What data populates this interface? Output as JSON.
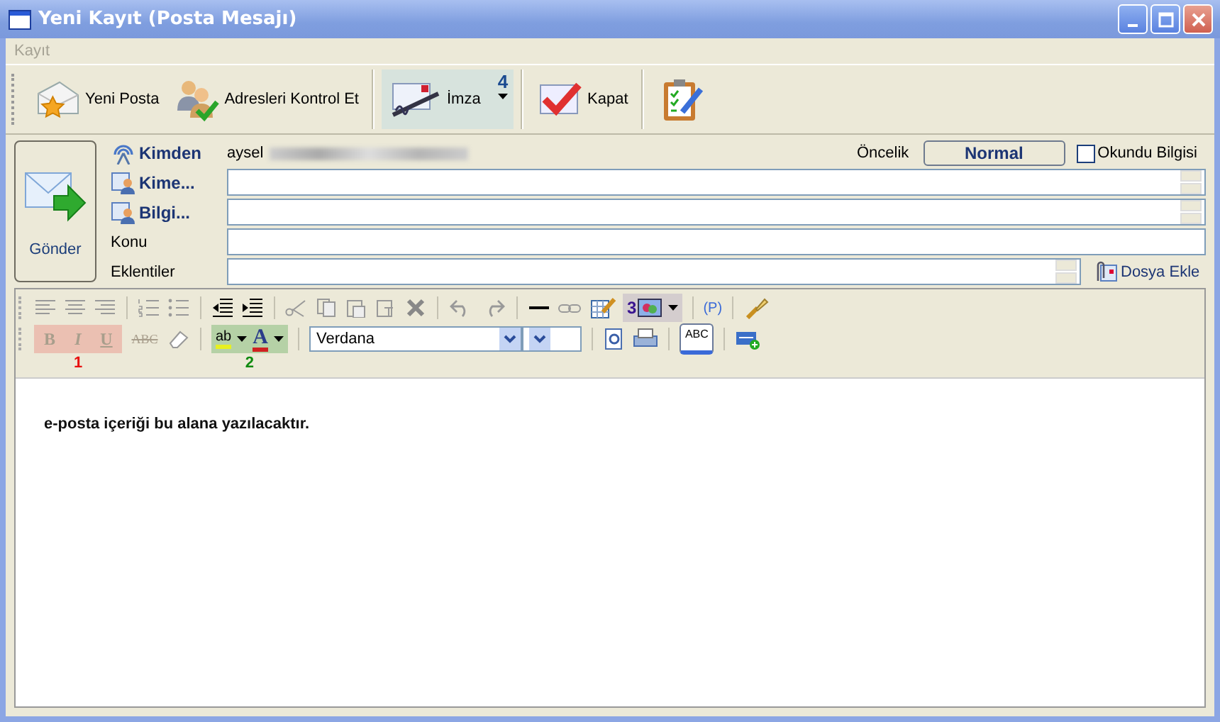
{
  "window": {
    "title": "Yeni Kayıt (Posta Mesajı)"
  },
  "menu": [
    {
      "label": "Kayıt",
      "disabled": true
    }
  ],
  "toolbar": [
    {
      "kind": "new-mail",
      "label": "Yeni Posta",
      "highlighted": false
    },
    {
      "kind": "check-addresses",
      "label": "Adresleri Kontrol Et",
      "highlighted": false
    },
    {
      "kind": "signature",
      "label": "İmza",
      "highlighted": true,
      "callout": "4"
    },
    {
      "kind": "close",
      "label": "Kapat",
      "highlighted": false
    },
    {
      "kind": "tasks",
      "highlighted": false
    }
  ],
  "header": {
    "send_button": "Gönder",
    "from_label": "Kimden",
    "from_value": "aysel",
    "priority_label": "Öncelik",
    "priority_value": "Normal",
    "read_receipt": {
      "label": "Okundu Bilgisi",
      "checked": false
    },
    "fields": [
      {
        "kind": "address",
        "label": "Kime..."
      },
      {
        "kind": "address",
        "label": "Bilgi..."
      },
      {
        "kind": "text",
        "label": "Konu"
      },
      {
        "kind": "attachment",
        "label": "Eklentiler"
      }
    ],
    "attach_button": "Dosya Ekle"
  },
  "editor": {
    "paragraph_button": "(P)",
    "format_buttons": [
      "B",
      "I",
      "U",
      "ABC"
    ],
    "highlight_glyph": "ab",
    "font_color_glyph": "A",
    "spell_glyph": "ABC",
    "font_name": "Verdana",
    "callouts": [
      {
        "label": "1",
        "color": "#e81010"
      },
      {
        "label": "2",
        "color": "#108a10"
      },
      {
        "label": "3",
        "color": "#3a1490"
      }
    ],
    "body": "e-posta içeriği bu alana yazılacaktır."
  }
}
